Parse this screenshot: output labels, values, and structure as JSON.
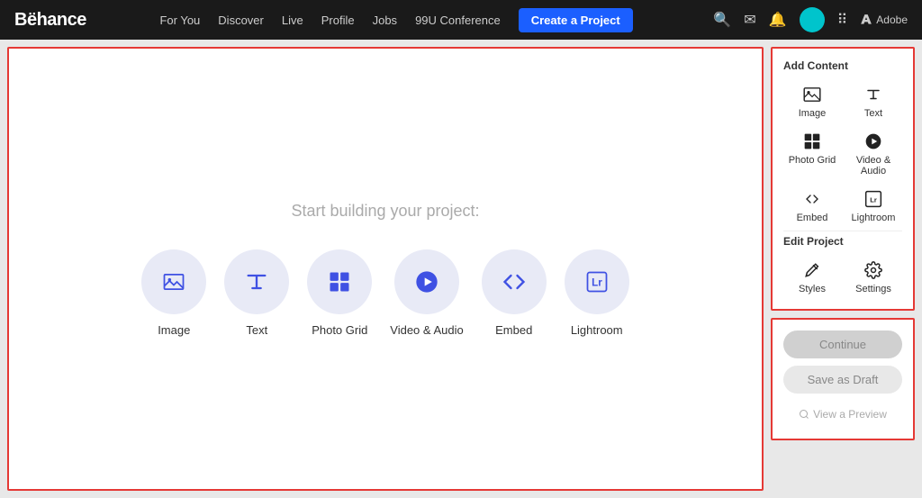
{
  "navbar": {
    "logo": "Bëhance",
    "links": [
      {
        "label": "For You"
      },
      {
        "label": "Discover"
      },
      {
        "label": "Live"
      },
      {
        "label": "Profile"
      },
      {
        "label": "Jobs"
      },
      {
        "label": "99U Conference"
      }
    ],
    "cta_label": "Create a Project",
    "adobe_label": "Adobe"
  },
  "canvas": {
    "prompt": "Start building your project:",
    "options": [
      {
        "id": "image",
        "label": "Image"
      },
      {
        "id": "text",
        "label": "Text"
      },
      {
        "id": "photo-grid",
        "label": "Photo Grid"
      },
      {
        "id": "video-audio",
        "label": "Video & Audio"
      },
      {
        "id": "embed",
        "label": "Embed"
      },
      {
        "id": "lightroom",
        "label": "Lightroom"
      }
    ]
  },
  "sidebar": {
    "add_content_title": "Add Content",
    "items": [
      {
        "id": "image",
        "label": "Image"
      },
      {
        "id": "text",
        "label": "Text"
      },
      {
        "id": "photo-grid",
        "label": "Photo Grid"
      },
      {
        "id": "video-audio",
        "label": "Video & Audio"
      },
      {
        "id": "embed",
        "label": "Embed"
      },
      {
        "id": "lightroom",
        "label": "Lightroom"
      }
    ],
    "edit_project_title": "Edit Project",
    "edit_items": [
      {
        "id": "styles",
        "label": "Styles"
      },
      {
        "id": "settings",
        "label": "Settings"
      }
    ]
  },
  "actions": {
    "continue_label": "Continue",
    "draft_label": "Save as Draft",
    "preview_label": "View a Preview"
  }
}
